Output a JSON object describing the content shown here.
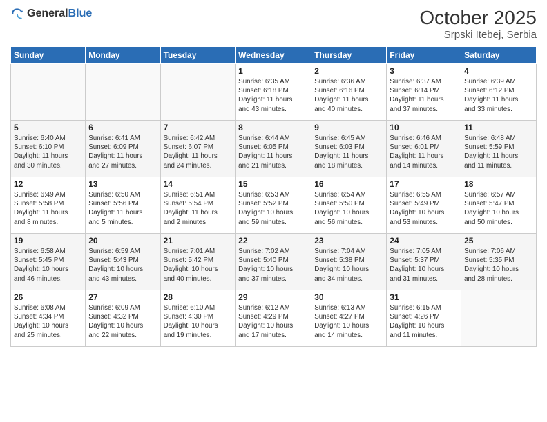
{
  "header": {
    "logo_general": "General",
    "logo_blue": "Blue",
    "title": "October 2025",
    "subtitle": "Srpski Itebej, Serbia"
  },
  "days_of_week": [
    "Sunday",
    "Monday",
    "Tuesday",
    "Wednesday",
    "Thursday",
    "Friday",
    "Saturday"
  ],
  "weeks": [
    [
      {
        "day": "",
        "info": ""
      },
      {
        "day": "",
        "info": ""
      },
      {
        "day": "",
        "info": ""
      },
      {
        "day": "1",
        "info": "Sunrise: 6:35 AM\nSunset: 6:18 PM\nDaylight: 11 hours\nand 43 minutes."
      },
      {
        "day": "2",
        "info": "Sunrise: 6:36 AM\nSunset: 6:16 PM\nDaylight: 11 hours\nand 40 minutes."
      },
      {
        "day": "3",
        "info": "Sunrise: 6:37 AM\nSunset: 6:14 PM\nDaylight: 11 hours\nand 37 minutes."
      },
      {
        "day": "4",
        "info": "Sunrise: 6:39 AM\nSunset: 6:12 PM\nDaylight: 11 hours\nand 33 minutes."
      }
    ],
    [
      {
        "day": "5",
        "info": "Sunrise: 6:40 AM\nSunset: 6:10 PM\nDaylight: 11 hours\nand 30 minutes."
      },
      {
        "day": "6",
        "info": "Sunrise: 6:41 AM\nSunset: 6:09 PM\nDaylight: 11 hours\nand 27 minutes."
      },
      {
        "day": "7",
        "info": "Sunrise: 6:42 AM\nSunset: 6:07 PM\nDaylight: 11 hours\nand 24 minutes."
      },
      {
        "day": "8",
        "info": "Sunrise: 6:44 AM\nSunset: 6:05 PM\nDaylight: 11 hours\nand 21 minutes."
      },
      {
        "day": "9",
        "info": "Sunrise: 6:45 AM\nSunset: 6:03 PM\nDaylight: 11 hours\nand 18 minutes."
      },
      {
        "day": "10",
        "info": "Sunrise: 6:46 AM\nSunset: 6:01 PM\nDaylight: 11 hours\nand 14 minutes."
      },
      {
        "day": "11",
        "info": "Sunrise: 6:48 AM\nSunset: 5:59 PM\nDaylight: 11 hours\nand 11 minutes."
      }
    ],
    [
      {
        "day": "12",
        "info": "Sunrise: 6:49 AM\nSunset: 5:58 PM\nDaylight: 11 hours\nand 8 minutes."
      },
      {
        "day": "13",
        "info": "Sunrise: 6:50 AM\nSunset: 5:56 PM\nDaylight: 11 hours\nand 5 minutes."
      },
      {
        "day": "14",
        "info": "Sunrise: 6:51 AM\nSunset: 5:54 PM\nDaylight: 11 hours\nand 2 minutes."
      },
      {
        "day": "15",
        "info": "Sunrise: 6:53 AM\nSunset: 5:52 PM\nDaylight: 10 hours\nand 59 minutes."
      },
      {
        "day": "16",
        "info": "Sunrise: 6:54 AM\nSunset: 5:50 PM\nDaylight: 10 hours\nand 56 minutes."
      },
      {
        "day": "17",
        "info": "Sunrise: 6:55 AM\nSunset: 5:49 PM\nDaylight: 10 hours\nand 53 minutes."
      },
      {
        "day": "18",
        "info": "Sunrise: 6:57 AM\nSunset: 5:47 PM\nDaylight: 10 hours\nand 50 minutes."
      }
    ],
    [
      {
        "day": "19",
        "info": "Sunrise: 6:58 AM\nSunset: 5:45 PM\nDaylight: 10 hours\nand 46 minutes."
      },
      {
        "day": "20",
        "info": "Sunrise: 6:59 AM\nSunset: 5:43 PM\nDaylight: 10 hours\nand 43 minutes."
      },
      {
        "day": "21",
        "info": "Sunrise: 7:01 AM\nSunset: 5:42 PM\nDaylight: 10 hours\nand 40 minutes."
      },
      {
        "day": "22",
        "info": "Sunrise: 7:02 AM\nSunset: 5:40 PM\nDaylight: 10 hours\nand 37 minutes."
      },
      {
        "day": "23",
        "info": "Sunrise: 7:04 AM\nSunset: 5:38 PM\nDaylight: 10 hours\nand 34 minutes."
      },
      {
        "day": "24",
        "info": "Sunrise: 7:05 AM\nSunset: 5:37 PM\nDaylight: 10 hours\nand 31 minutes."
      },
      {
        "day": "25",
        "info": "Sunrise: 7:06 AM\nSunset: 5:35 PM\nDaylight: 10 hours\nand 28 minutes."
      }
    ],
    [
      {
        "day": "26",
        "info": "Sunrise: 6:08 AM\nSunset: 4:34 PM\nDaylight: 10 hours\nand 25 minutes."
      },
      {
        "day": "27",
        "info": "Sunrise: 6:09 AM\nSunset: 4:32 PM\nDaylight: 10 hours\nand 22 minutes."
      },
      {
        "day": "28",
        "info": "Sunrise: 6:10 AM\nSunset: 4:30 PM\nDaylight: 10 hours\nand 19 minutes."
      },
      {
        "day": "29",
        "info": "Sunrise: 6:12 AM\nSunset: 4:29 PM\nDaylight: 10 hours\nand 17 minutes."
      },
      {
        "day": "30",
        "info": "Sunrise: 6:13 AM\nSunset: 4:27 PM\nDaylight: 10 hours\nand 14 minutes."
      },
      {
        "day": "31",
        "info": "Sunrise: 6:15 AM\nSunset: 4:26 PM\nDaylight: 10 hours\nand 11 minutes."
      },
      {
        "day": "",
        "info": ""
      }
    ]
  ]
}
